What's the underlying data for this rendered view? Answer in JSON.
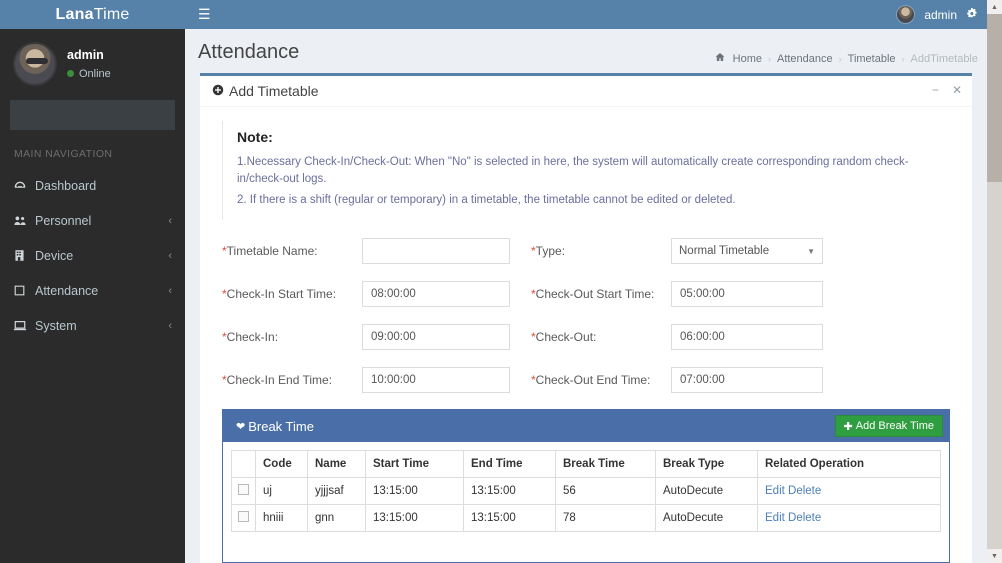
{
  "brand": {
    "name_bold": "Lana",
    "name_light": "Time"
  },
  "sidebar": {
    "user": {
      "name": "admin",
      "status": "Online"
    },
    "search": {
      "value": "",
      "placeholder": ""
    },
    "nav_header": "MAIN NAVIGATION",
    "items": [
      {
        "label": "Dashboard",
        "icon": "dashboard-icon",
        "caret": ""
      },
      {
        "label": "Personnel",
        "icon": "users-icon",
        "caret": "‹"
      },
      {
        "label": "Device",
        "icon": "device-icon",
        "caret": "‹"
      },
      {
        "label": "Attendance",
        "icon": "attendance-icon",
        "caret": "‹"
      },
      {
        "label": "System",
        "icon": "system-icon",
        "caret": "‹"
      }
    ]
  },
  "topnav": {
    "user": "admin",
    "hamburger": "☰",
    "gear": "gear-icon"
  },
  "page": {
    "title": "Attendance",
    "breadcrumb": [
      {
        "label": "Home",
        "type": "link"
      },
      {
        "label": "Attendance",
        "type": "link"
      },
      {
        "label": "Timetable",
        "type": "link"
      },
      {
        "label": "AddTimetable",
        "type": "active"
      }
    ],
    "separator": "›"
  },
  "box": {
    "title": "Add Timetable",
    "minimize": "−",
    "close": "✕"
  },
  "note": {
    "heading": "Note:",
    "lines": [
      "1.Necessary Check-In/Check-Out: When \"No\" is selected in here, the system will automatically create corresponding random check-in/check-out logs.",
      "2. If there is a shift (regular or temporary) in a timetable, the timetable cannot be edited or deleted."
    ]
  },
  "form": {
    "rows": [
      {
        "left": {
          "label": "Timetable Name:",
          "required": true,
          "value": "",
          "placeholder": "",
          "control": "text"
        },
        "right": {
          "label": "Type:",
          "required": true,
          "value": "Normal Timetable",
          "control": "select"
        }
      },
      {
        "left": {
          "label": "Check-In Start Time:",
          "required": true,
          "value": "08:00:00",
          "placeholder": "",
          "control": "text"
        },
        "right": {
          "label": "Check-Out Start Time:",
          "required": true,
          "value": "05:00:00",
          "placeholder": "",
          "control": "text"
        }
      },
      {
        "left": {
          "label": "Check-In:",
          "required": true,
          "value": "09:00:00",
          "placeholder": "",
          "control": "text"
        },
        "right": {
          "label": "Check-Out:",
          "required": true,
          "value": "06:00:00",
          "placeholder": "",
          "control": "text"
        }
      },
      {
        "left": {
          "label": "Check-In End Time:",
          "required": true,
          "value": "10:00:00",
          "placeholder": "",
          "control": "text"
        },
        "right": {
          "label": "Check-Out End Time:",
          "required": true,
          "value": "07:00:00",
          "placeholder": "",
          "control": "text"
        }
      }
    ],
    "type_selected": "Normal Timetable"
  },
  "break_time": {
    "panel_title": "Break Time",
    "add_button": "Add Break Time",
    "add_icon": "plus-icon",
    "columns": [
      "",
      "Code",
      "Name",
      "Start Time",
      "End Time",
      "Break Time",
      "Break Type",
      "Related Operation"
    ],
    "rows": [
      {
        "code": "uj",
        "name": "yjjjsaf",
        "start": "13:15:00",
        "end": "13:15:00",
        "break": "56",
        "type": "AutoDecute",
        "edit": "Edit",
        "delete": "Delete"
      },
      {
        "code": "hniii",
        "name": "gnn",
        "start": "13:15:00",
        "end": "13:15:00",
        "break": "78",
        "type": "AutoDecute",
        "edit": "Edit",
        "delete": "Delete"
      }
    ]
  },
  "colors": {
    "header_blue": "#5682a9",
    "sidebar_dark": "#2b2b2b",
    "panel_blue": "#4a6fa8",
    "button_green": "#2f9e41",
    "required_red": "#dd4b39",
    "note_text": "#6a6f9c",
    "link_blue": "#4c7fb5"
  },
  "scrollbar": {
    "up": "▲",
    "down": "▼"
  }
}
